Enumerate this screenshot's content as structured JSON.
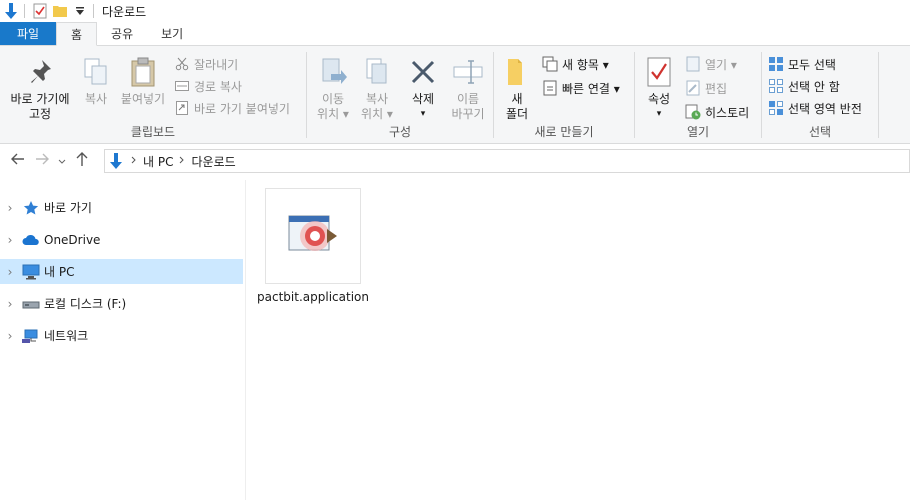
{
  "window": {
    "title": "다운로드"
  },
  "tabs": [
    {
      "label": "파일"
    },
    {
      "label": "홈"
    },
    {
      "label": "공유"
    },
    {
      "label": "보기"
    }
  ],
  "ribbon": {
    "clipboard": {
      "group_label": "클립보드",
      "pin_line1": "바로 가기에",
      "pin_line2": "고정",
      "copy": "복사",
      "paste": "붙여넣기",
      "cut": "잘라내기",
      "copy_path": "경로 복사",
      "paste_shortcut": "바로 가기 붙여넣기"
    },
    "organize": {
      "group_label": "구성",
      "move_line1": "이동",
      "move_line2": "위치 ▾",
      "copyto_line1": "복사",
      "copyto_line2": "위치 ▾",
      "delete_line1": "삭제",
      "delete_line2": "▾",
      "rename_line1": "이름",
      "rename_line2": "바꾸기"
    },
    "new": {
      "group_label": "새로 만들기",
      "new_folder_line1": "새",
      "new_folder_line2": "폴더",
      "new_item": "새 항목 ▾",
      "easy_access": "빠른 연결 ▾"
    },
    "open": {
      "group_label": "열기",
      "properties": "속성",
      "properties_arrow": "▾",
      "open": "열기 ▾",
      "edit": "편집",
      "history": "히스토리"
    },
    "select": {
      "group_label": "선택",
      "select_all": "모두 선택",
      "select_none": "선택 안 함",
      "invert": "선택 영역 반전"
    }
  },
  "address": {
    "crumbs": [
      {
        "label": "내 PC"
      },
      {
        "label": "다운로드"
      }
    ]
  },
  "nav": {
    "items": [
      {
        "label": "바로 가기"
      },
      {
        "label": "OneDrive"
      },
      {
        "label": "내 PC"
      },
      {
        "label": "로컬 디스크 (F:)"
      },
      {
        "label": "네트워크"
      }
    ]
  },
  "files": [
    {
      "name": "pactbit.application"
    }
  ],
  "colors": {
    "accent": "#1979ca",
    "selection": "#cce8ff",
    "ribbon_bg": "#f5f6f7"
  }
}
